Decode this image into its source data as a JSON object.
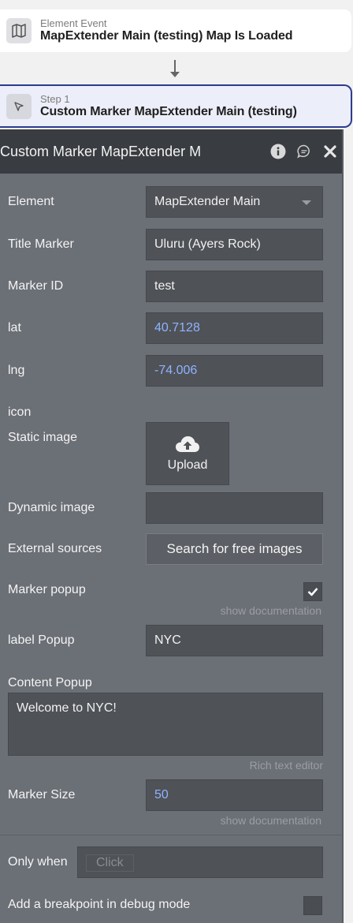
{
  "event_card": {
    "kicker": "Element Event",
    "title": "MapExtender Main (testing) Map Is Loaded",
    "icon": "map-icon"
  },
  "step_card": {
    "kicker": "Step 1",
    "title": "Custom Marker MapExtender Main (testing)",
    "icon": "cursor-icon"
  },
  "panel": {
    "title": "Custom Marker MapExtender M",
    "header_icons": [
      "info-icon",
      "comment-icon",
      "close-icon"
    ],
    "fields": {
      "element": {
        "label": "Element",
        "value": "MapExtender Main"
      },
      "title_marker": {
        "label": "Title Marker",
        "value": "Uluru (Ayers Rock)"
      },
      "marker_id": {
        "label": "Marker ID",
        "value": "test"
      },
      "lat": {
        "label": "lat",
        "value": "40.7128"
      },
      "lng": {
        "label": "lng",
        "value": "-74.006"
      },
      "icon_section": {
        "label": "icon"
      },
      "static_image": {
        "label": "Static image",
        "button": "Upload"
      },
      "dynamic_image": {
        "label": "Dynamic image",
        "value": ""
      },
      "external_sources": {
        "label": "External sources",
        "button": "Search for free images"
      },
      "marker_popup": {
        "label": "Marker popup",
        "checked": true,
        "doc_link": "show documentation"
      },
      "label_popup": {
        "label": "label Popup",
        "value": "NYC"
      },
      "content_popup": {
        "label": "Content Popup",
        "value": "Welcome to NYC!",
        "editor_link": "Rich text editor"
      },
      "marker_size": {
        "label": "Marker Size",
        "value": "50",
        "doc_link": "show documentation"
      }
    },
    "only_when": {
      "label": "Only when",
      "placeholder": "Click"
    },
    "debug": {
      "label": "Add a breakpoint in debug mode",
      "checked": false
    }
  },
  "colors": {
    "panel_bg": "#6b6f76",
    "header_bg": "#393c41",
    "field_bg": "#4f5257",
    "dynamic_value": "#8fb3ff",
    "step_border": "#2c3b8f"
  }
}
